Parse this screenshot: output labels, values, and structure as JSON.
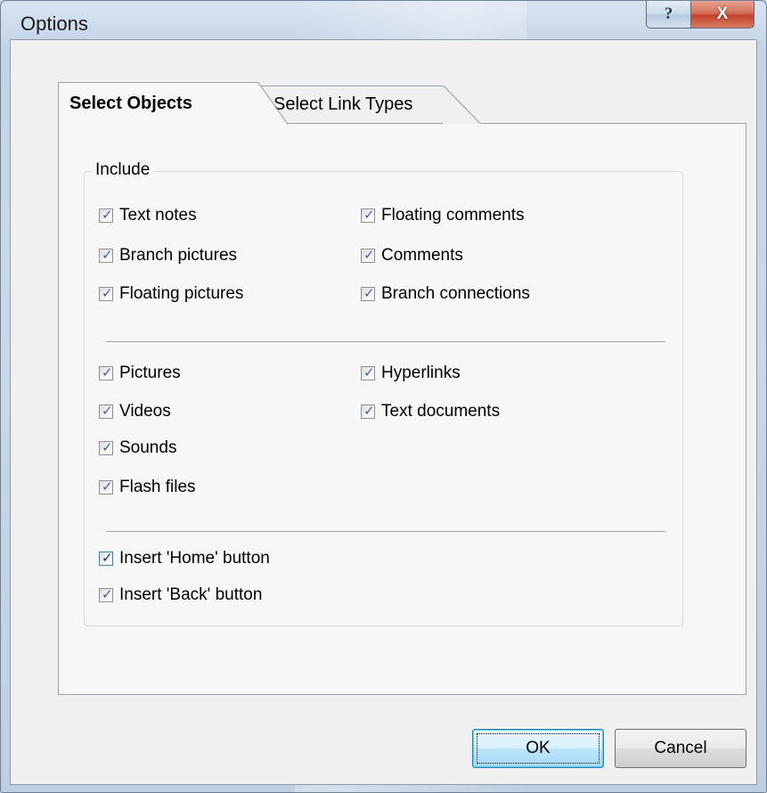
{
  "window": {
    "title": "Options",
    "help_glyph": "?",
    "close_glyph": "X",
    "help_icon": "question-mark",
    "close_icon": "close-x"
  },
  "tabs": [
    {
      "label": "Select Objects",
      "active": true
    },
    {
      "label": "Select Link Types",
      "active": false
    }
  ],
  "group": {
    "label": "Include",
    "section1": {
      "left": [
        {
          "label": "Text notes",
          "checked": true
        },
        {
          "label": "Branch pictures",
          "checked": true
        },
        {
          "label": "Floating pictures",
          "checked": true
        }
      ],
      "right": [
        {
          "label": "Floating comments",
          "checked": true
        },
        {
          "label": "Comments",
          "checked": true
        },
        {
          "label": "Branch connections",
          "checked": true
        }
      ]
    },
    "section2": {
      "left": [
        {
          "label": "Pictures",
          "checked": true
        },
        {
          "label": "Videos",
          "checked": true
        },
        {
          "label": "Sounds",
          "checked": true
        },
        {
          "label": "Flash files",
          "checked": true
        }
      ],
      "right": [
        {
          "label": "Hyperlinks",
          "checked": true
        },
        {
          "label": "Text documents",
          "checked": true
        }
      ]
    },
    "section3": [
      {
        "label": "Insert 'Home' button",
        "checked": true
      },
      {
        "label": "Insert 'Back' button",
        "checked": true
      }
    ]
  },
  "buttons": {
    "ok": "OK",
    "cancel": "Cancel"
  },
  "check_glyph": "✓",
  "colors": {
    "accent_blue": "#3c7fb1",
    "close_red": "#c2432c",
    "dialog_bg": "#f0f0f0"
  }
}
